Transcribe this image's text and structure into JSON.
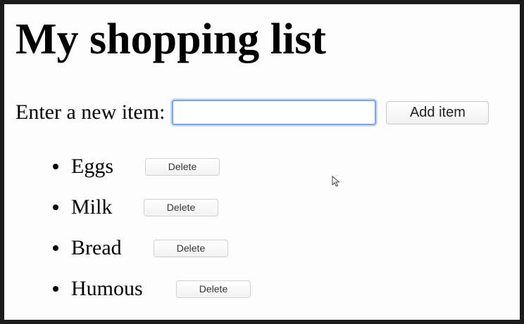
{
  "page": {
    "title": "My shopping list"
  },
  "form": {
    "label": "Enter a new item:",
    "input_value": "",
    "add_button_label": "Add item"
  },
  "items": [
    {
      "name": "Eggs",
      "delete_label": "Delete"
    },
    {
      "name": "Milk",
      "delete_label": "Delete"
    },
    {
      "name": "Bread",
      "delete_label": "Delete"
    },
    {
      "name": "Humous",
      "delete_label": "Delete"
    }
  ],
  "icons": {
    "pointer": "mouse-pointer-icon"
  }
}
